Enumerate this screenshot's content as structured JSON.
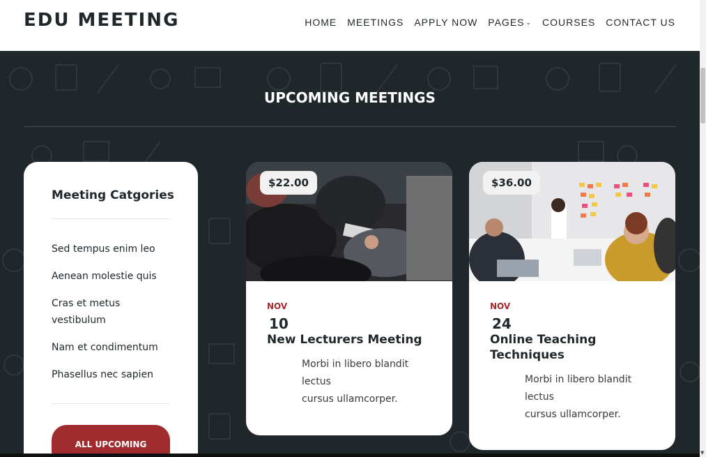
{
  "header": {
    "logo": "EDU MEETING",
    "nav": [
      {
        "label": "HOME"
      },
      {
        "label": "MEETINGS"
      },
      {
        "label": "APPLY NOW"
      },
      {
        "label": "PAGES",
        "has_dropdown": true
      },
      {
        "label": "COURSES"
      },
      {
        "label": "CONTACT US"
      }
    ]
  },
  "section": {
    "title": "UPCOMING MEETINGS",
    "background_color": "#1f272b"
  },
  "categories": {
    "title": "Meeting Catgories",
    "items": [
      "Sed tempus enim leo",
      "Aenean molestie quis",
      "Cras et metus vestibulum",
      "Nam et condimentum",
      "Phasellus nec sapien"
    ],
    "button_label": "ALL UPCOMING MEETINGS"
  },
  "meetings": [
    {
      "price": "$22.00",
      "month": "NOV",
      "day": "10",
      "title": "New Lecturers Meeting",
      "description_line1": "Morbi in libero blandit lectus",
      "description_line2": "cursus ullamcorper."
    },
    {
      "price": "$36.00",
      "month": "NOV",
      "day": "24",
      "title": "Online Teaching Techniques",
      "description_line1": "Morbi in libero blandit lectus",
      "description_line2": "cursus ullamcorper."
    }
  ],
  "colors": {
    "accent": "#a12c2f",
    "dark": "#1f272b"
  }
}
